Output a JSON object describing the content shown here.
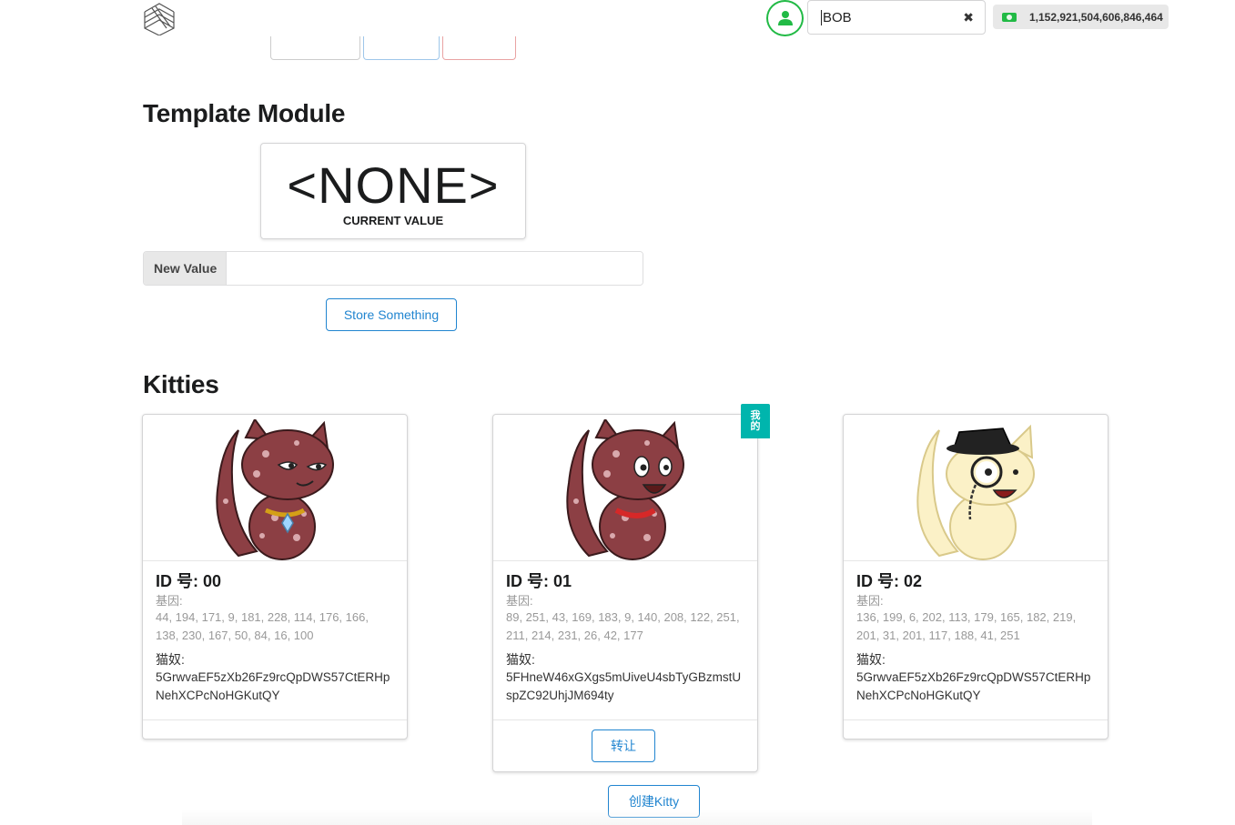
{
  "header": {
    "account_value": "BOB",
    "balance": "1,152,921,504,606,846,464",
    "clear_icon": "✖"
  },
  "template_module": {
    "title": "Template Module",
    "current_value": "<NONE>",
    "current_value_label": "CURRENT VALUE",
    "input_label": "New Value",
    "input_placeholder": "",
    "store_button": "Store Something"
  },
  "kitties": {
    "title": "Kitties",
    "mine_tag": [
      "我",
      "的"
    ],
    "create_button": "创建Kitty",
    "transfer_button": "转让",
    "items": [
      {
        "id_label": "ID 号: 00",
        "genes_label": "基因:",
        "genes": "44, 194, 171, 9, 181, 228, 114, 176, 166, 138, 230, 167, 50, 84, 16, 100",
        "owner_label": "猫奴:",
        "owner": "5GrwvaEF5zXb26Fz9rcQpDWS57CtERHpNehXCPcNoHGKutQY",
        "colors": {
          "body": "#8c3f44",
          "spots": "#d9a9ad"
        }
      },
      {
        "id_label": "ID 号: 01",
        "genes_label": "基因:",
        "genes": "89, 251, 43, 169, 183, 9, 140, 208, 122, 251, 211, 214, 231, 26, 42, 177",
        "owner_label": "猫奴:",
        "owner": "5FHneW46xGXgs5mUiveU4sbTyGBzmstUspZC92UhjJM694ty",
        "colors": {
          "body": "#8c3f44",
          "spots": "#d9a9ad"
        }
      },
      {
        "id_label": "ID 号: 02",
        "genes_label": "基因:",
        "genes": "136, 199, 6, 202, 113, 179, 165, 182, 219, 201, 31, 201, 117, 188, 41, 251",
        "owner_label": "猫奴:",
        "owner": "5GrwvaEF5zXb26Fz9rcQpDWS57CtERHpNehXCPcNoHGKutQY",
        "colors": {
          "body": "#fbf1c7",
          "spots": "#f1dfa0"
        }
      }
    ]
  },
  "colors": {
    "primary": "#2185d0",
    "teal": "#00b5ad",
    "green": "#21ba45"
  }
}
